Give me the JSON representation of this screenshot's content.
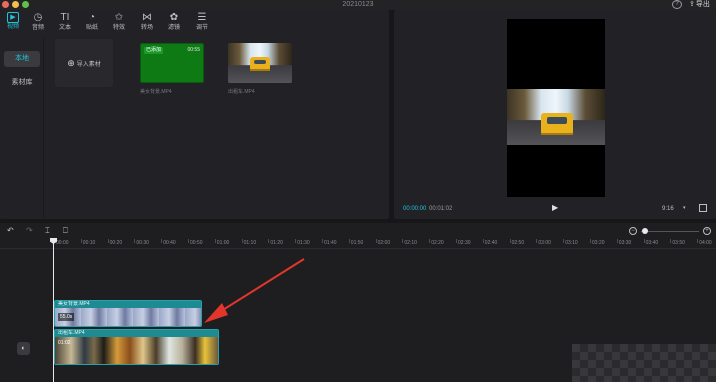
{
  "window": {
    "title": "20210123",
    "export_label": "导出"
  },
  "toolbar": {
    "items": [
      {
        "label": "视频",
        "icon": "video-icon",
        "active": true
      },
      {
        "label": "音频",
        "icon": "audio-icon",
        "active": false
      },
      {
        "label": "文本",
        "icon": "text-icon",
        "active": false
      },
      {
        "label": "贴纸",
        "icon": "sticker-icon",
        "active": false
      },
      {
        "label": "特效",
        "icon": "effects-icon",
        "active": false
      },
      {
        "label": "转场",
        "icon": "transition-icon",
        "active": false
      },
      {
        "label": "滤镜",
        "icon": "filter-icon",
        "active": false
      },
      {
        "label": "调节",
        "icon": "adjust-icon",
        "active": false
      }
    ]
  },
  "side_nav": {
    "items": [
      {
        "label": "本地",
        "active": true
      },
      {
        "label": "素材库",
        "active": false
      }
    ]
  },
  "media": {
    "import_label": "导入素材",
    "items": [
      {
        "name": "美女背景.MP4",
        "badge": "已添加",
        "duration": "00:55"
      },
      {
        "name": "出租车.MP4",
        "badge": "",
        "duration": ""
      }
    ]
  },
  "preview": {
    "current_time": "00:00:00",
    "total_time": "00:01:02",
    "aspect_ratio": "9:16"
  },
  "timeline": {
    "ruler_labels": [
      "00:00",
      "00:10",
      "00:20",
      "00:30",
      "00:40",
      "00:50",
      "01:00",
      "01:10",
      "01:20",
      "01:30",
      "01:40",
      "01:50",
      "02:00",
      "02:10",
      "02:20",
      "02:30",
      "02:40",
      "02:50",
      "03:00",
      "03:10",
      "03:20",
      "03:30",
      "03:40",
      "03:50",
      "04:00"
    ],
    "clips": [
      {
        "name": "美女背景.MP4",
        "duration": "55.0s"
      },
      {
        "name": "出租车.MP4",
        "duration": "01:02"
      }
    ]
  },
  "colors": {
    "accent": "#20c4d8",
    "clip_header": "#1e8b93",
    "annotation_arrow": "#e2352b",
    "green_screen": "#0d7a14"
  }
}
